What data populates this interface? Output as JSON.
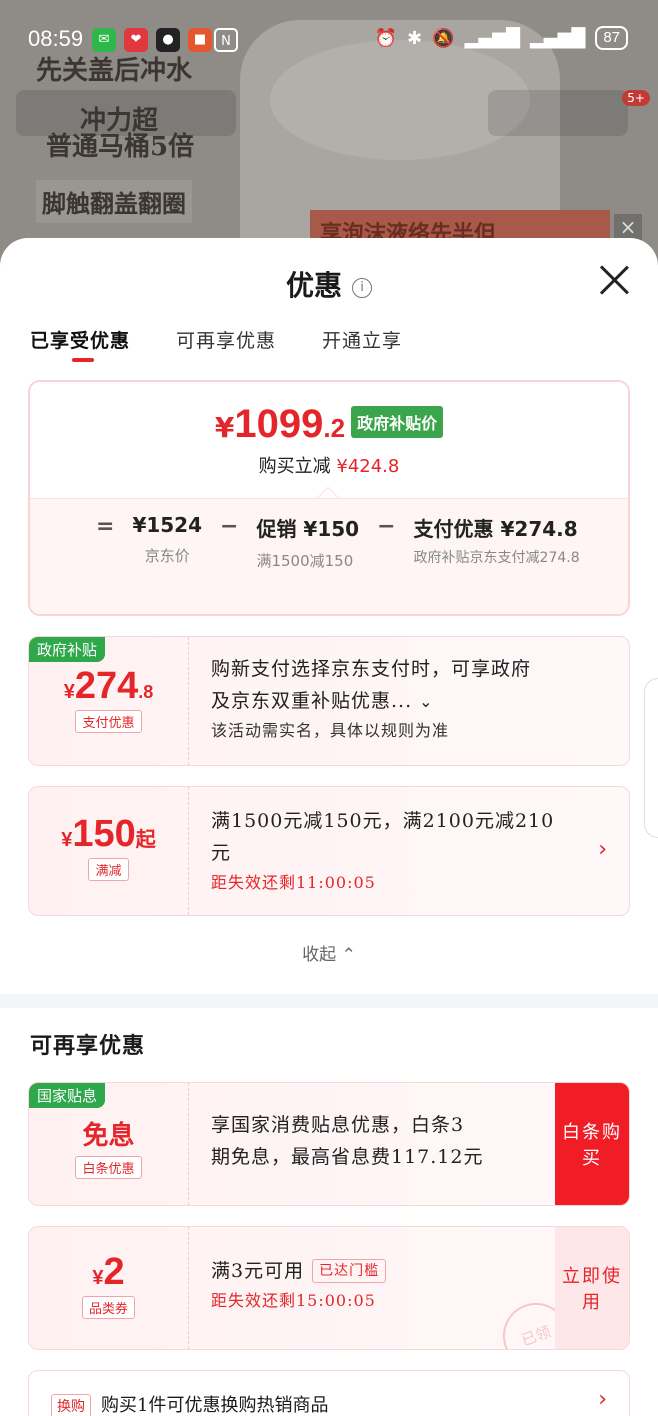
{
  "status_bar": {
    "time": "08:59",
    "battery": "87"
  },
  "background": {
    "ad_line1": "先关盖后冲水",
    "ad_line2": "冲力超",
    "ad_line3": "普通马桶5倍",
    "ad_line4": "脚触翻盖翻圈",
    "banner": "享泡沫液络先半但",
    "cart_badge": "5+"
  },
  "sheet": {
    "title": "优惠",
    "info_icon": "i",
    "tabs": [
      "已享受优惠",
      "可再享优惠",
      "开通立享"
    ],
    "active_tab": 0
  },
  "summary": {
    "currency": "¥",
    "price_int": "1099",
    "price_dec": ".2",
    "gov_tag": "政府补贴价",
    "reduce_label": "购买立减",
    "reduce_amount": "¥424.8",
    "calc": {
      "eq": "=",
      "minus": "−",
      "jd_price": "¥1524",
      "jd_label": "京东价",
      "promo_value": "促销 ¥150",
      "promo_label": "满1500减150",
      "pay_value": "支付优惠 ¥274.8",
      "pay_label": "政府补贴京东支付减274.8"
    }
  },
  "coupons": [
    {
      "corner": "政府补贴",
      "currency": "¥",
      "amount": "274",
      "decimal": ".8",
      "subtag": "支付优惠",
      "line1": "购新支付选择京东支付时，可享政府",
      "line2": "及京东双重补贴优惠...",
      "line3": "该活动需实名，具体以规则为准"
    },
    {
      "currency": "¥",
      "amount": "150",
      "suffix": "起",
      "subtag": "满减",
      "line1": "满1500元减150元，满2100元减210",
      "line2": "元",
      "countdown": "距失效还剩11:00:05"
    }
  ],
  "collapse_label": "收起",
  "more_section": {
    "title": "可再享优惠",
    "items": [
      {
        "corner": "国家贴息",
        "main": "免息",
        "subtag": "白条优惠",
        "line1": "享国家消费贴息优惠，白条3",
        "line2": "期免息，最高省息费117.12元",
        "action": "白条购买"
      },
      {
        "currency": "¥",
        "amount": "2",
        "subtag": "品类券",
        "line1": "满3元可用",
        "gate": "已达门槛",
        "countdown": "距失效还剩15:00:05",
        "action": "立即使用",
        "stamp": "已领"
      },
      {
        "tag": "换购",
        "line1": "购买1件可优惠换购热销商品"
      }
    ]
  },
  "colors": {
    "accent_red": "#e4262a",
    "gov_green": "#3aa54a"
  }
}
